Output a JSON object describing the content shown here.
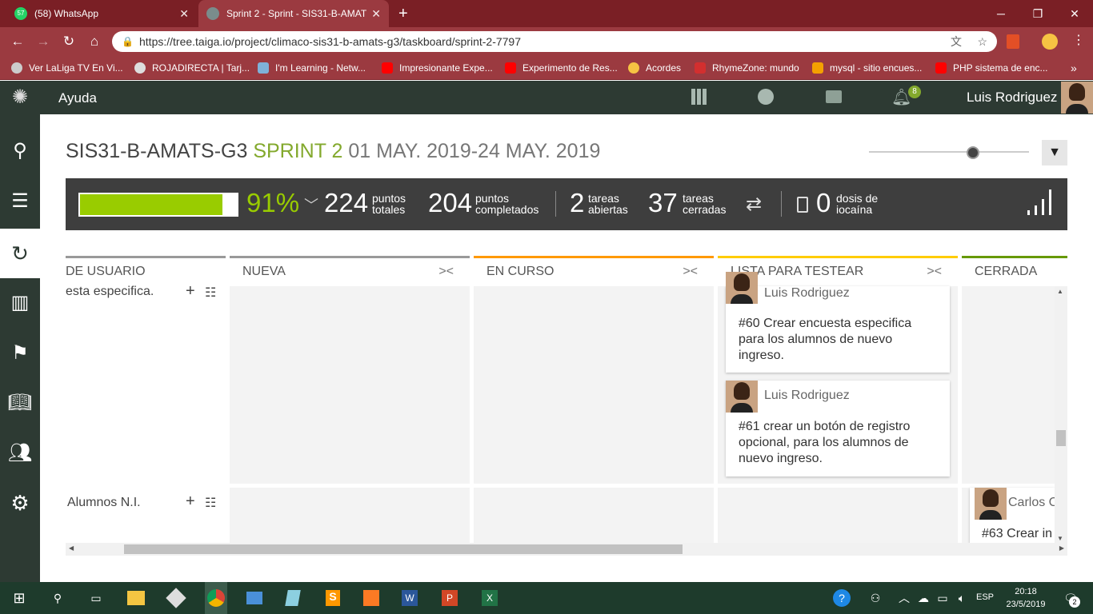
{
  "browser": {
    "tabs": [
      {
        "label": "(58) WhatsApp",
        "badge": "57"
      },
      {
        "label": "Sprint 2 - Sprint - SIS31-B-AMAT"
      }
    ],
    "url": "https://tree.taiga.io/project/climaco-sis31-b-amats-g3/taskboard/sprint-2-7797",
    "bookmarks": [
      "Ver LaLiga TV En Vi...",
      "ROJADIRECTA | Tarj...",
      "I'm Learning - Netw...",
      "Impresionante Expe...",
      "Experimento de Res...",
      "Acordes",
      "RhymeZone: mundo",
      "mysql - sitio encues...",
      "PHP sistema de enc..."
    ]
  },
  "topnav": {
    "help": "Ayuda",
    "notifications_count": "8",
    "user": "Luis Rodriguez"
  },
  "header": {
    "project": "SIS31-B-AMATS-G3",
    "sprint": "SPRINT 2",
    "dates": "01 MAY. 2019-24 MAY. 2019"
  },
  "stats": {
    "progress_fraction": 0.91,
    "percent": "91%",
    "total_points": "224",
    "total_points_label1": "puntos",
    "total_points_label2": "totales",
    "completed_points": "204",
    "completed_label1": "puntos",
    "completed_label2": "completados",
    "open_tasks": "2",
    "open_label1": "tareas",
    "open_label2": "abiertas",
    "closed_tasks": "37",
    "closed_label1": "tareas",
    "closed_label2": "cerradas",
    "iocaine": "0",
    "iocaine_label1": "dosis de",
    "iocaine_label2": "iocaína"
  },
  "columns": [
    {
      "label": "DE USUARIO",
      "color": "#999999"
    },
    {
      "label": "NUEVA",
      "color": "#999999"
    },
    {
      "label": "EN CURSO",
      "color": "#ff9900"
    },
    {
      "label": "LISTA PARA TESTEAR",
      "color": "#ffcc00"
    },
    {
      "label": "CERRADA",
      "color": "#669900"
    }
  ],
  "rows": [
    {
      "story": "esta especifica."
    },
    {
      "story": "Alumnos N.I."
    }
  ],
  "cards": [
    {
      "owner": "Luis Rodriguez",
      "text": "#60 Crear encuesta especifica para los alumnos de nuevo ingreso."
    },
    {
      "owner": "Luis Rodriguez",
      "text": "#61 crear un botón de registro opcional, para los alumnos de nuevo ingreso."
    },
    {
      "owner": "Carlos C",
      "text": "#63 Crear in"
    }
  ],
  "taskbar": {
    "lang": "ESP",
    "time": "20:18",
    "date": "23/5/2019",
    "notif_count": "2"
  },
  "colors": {
    "taiga_dark": "#2d3a33",
    "progress_green": "#99cc00",
    "sprint_green": "#83a92d",
    "chrome_maroon": "#9b3a40"
  }
}
